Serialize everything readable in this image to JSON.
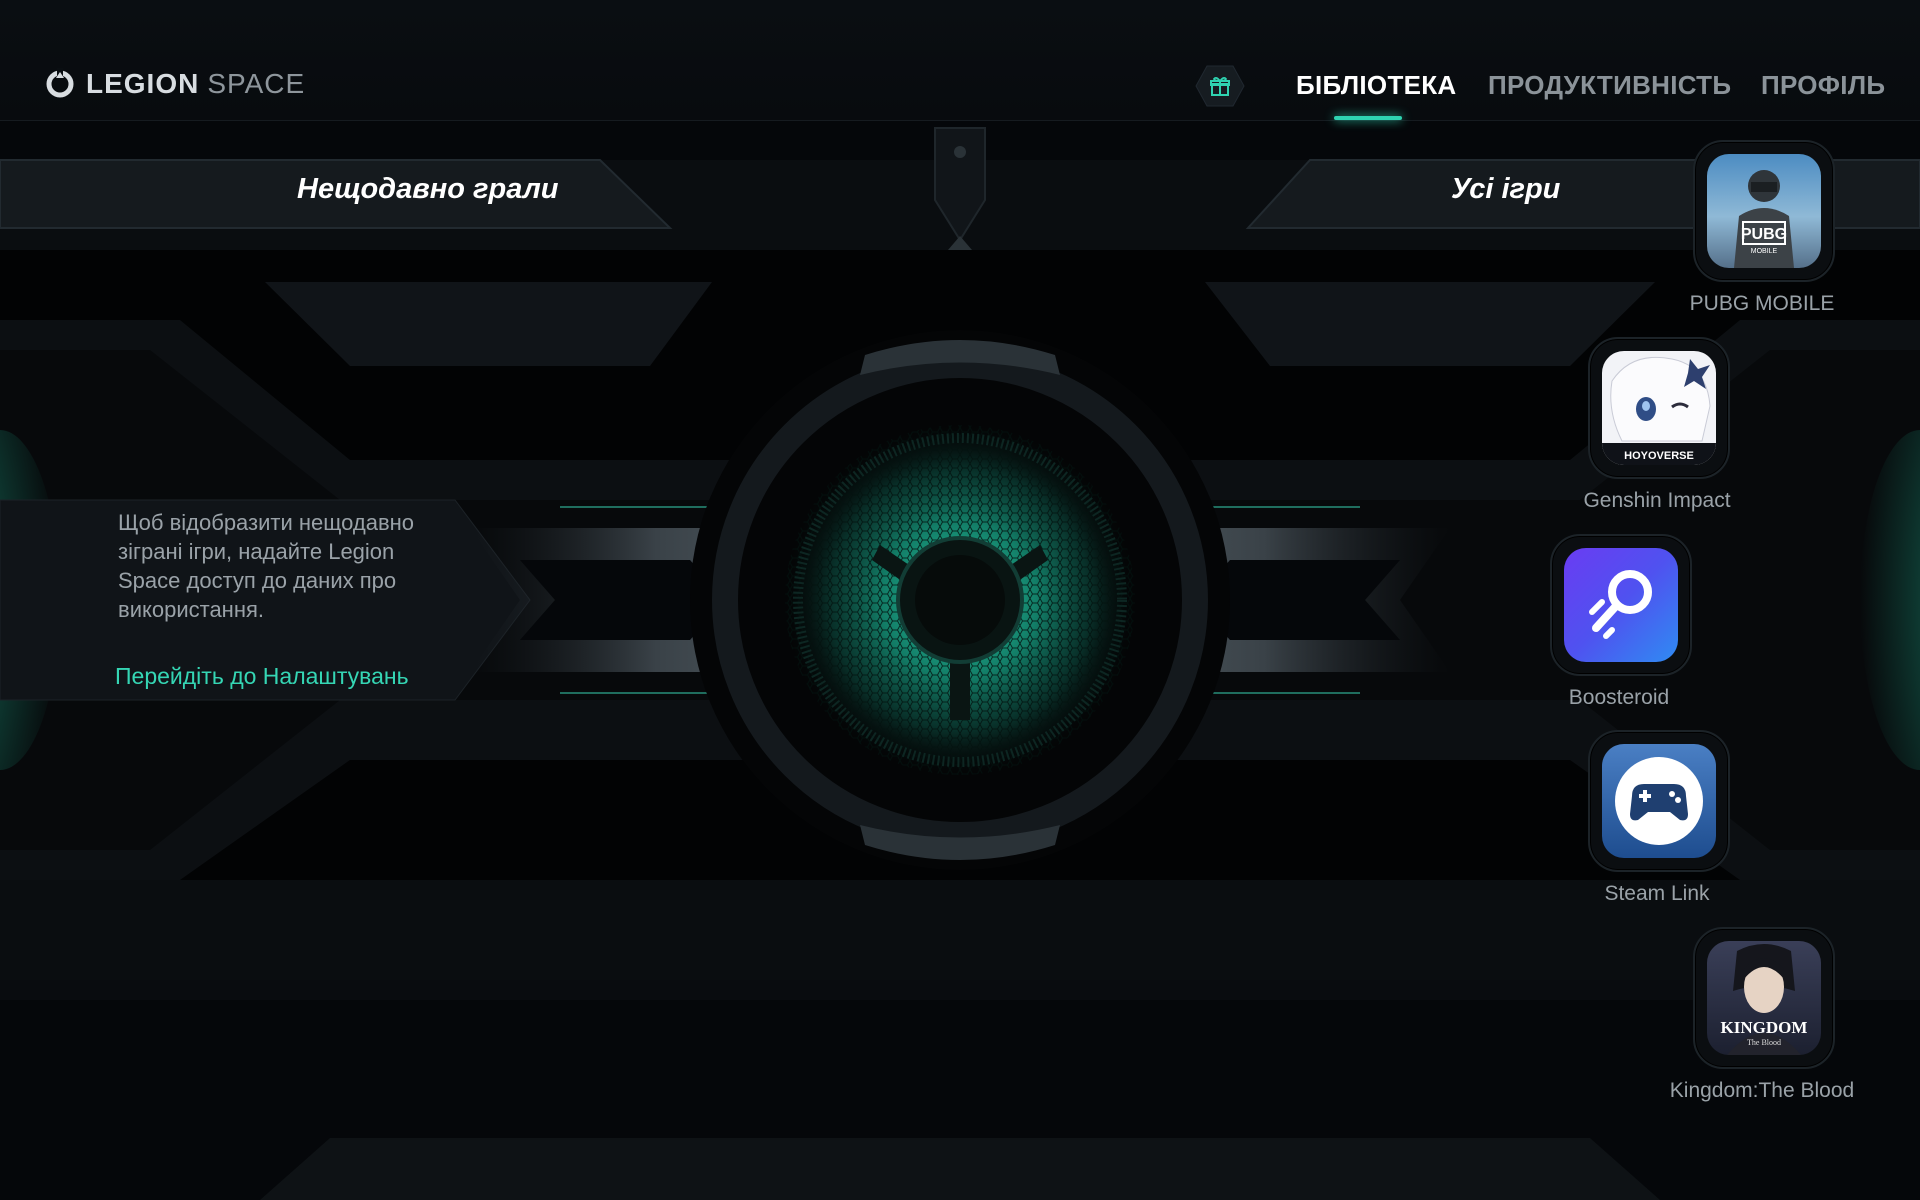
{
  "header": {
    "logo_primary": "LEGION",
    "logo_secondary": "SPACE",
    "gift_icon": "gift-icon",
    "tabs": [
      {
        "label": "БІБЛІОТЕКА",
        "active": true
      },
      {
        "label": "ПРОДУКТИВНІСТЬ",
        "active": false
      },
      {
        "label": "ПРОФІЛЬ",
        "active": false
      }
    ]
  },
  "recent": {
    "title": "Нещодавно грали",
    "hint": "Щоб відобразити нещодавно зіграні ігри, надайте Legion Space доступ до даних про використання.",
    "link": "Перейдіть до Налаштувань"
  },
  "all_games": {
    "title": "Усі ігри",
    "apps": [
      {
        "name": "PUBG MOBILE",
        "icon": "pubg-mobile-icon",
        "icon_text": "PUBG",
        "icon_subtext": "MOBILE"
      },
      {
        "name": "Genshin Impact",
        "icon": "genshin-impact-icon",
        "icon_text": "HOYOVERSE"
      },
      {
        "name": "Boosteroid",
        "icon": "boosteroid-icon"
      },
      {
        "name": "Steam Link",
        "icon": "steam-link-icon"
      },
      {
        "name": "Kingdom:The Blood",
        "icon": "kingdom-the-blood-icon",
        "icon_text": "KINGDOM",
        "icon_subtext": "The Blood"
      }
    ]
  },
  "colors": {
    "accent": "#2fd3b1",
    "background": "#05070a",
    "text_muted": "#9aa2a8"
  }
}
